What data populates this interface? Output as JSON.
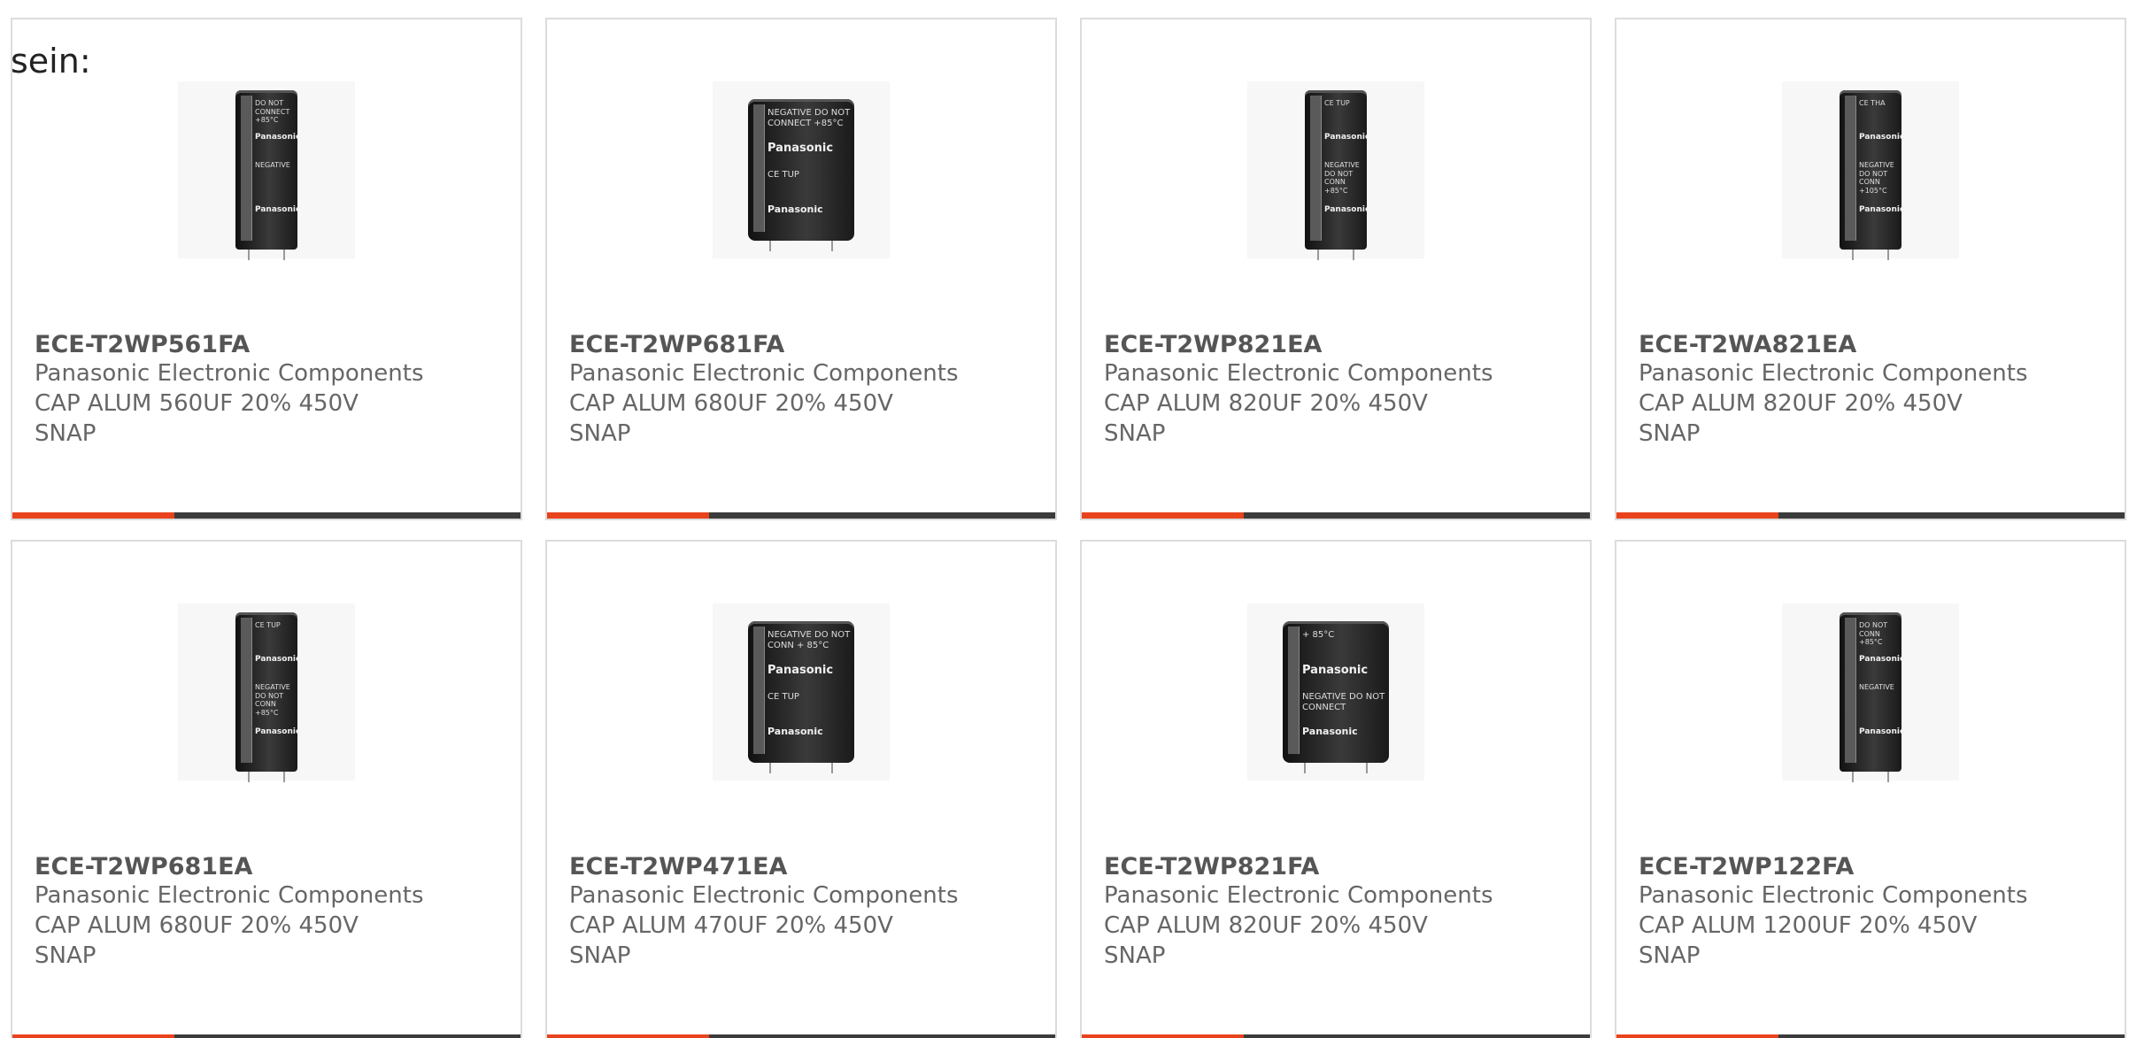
{
  "intro_text": "sein:",
  "colors": {
    "accent": "#e8431c",
    "bar_dark": "#3b3b3b",
    "border": "#dcdcdc"
  },
  "products": [
    {
      "part_number": "ECE-T2WP561FA",
      "manufacturer": "Panasonic Electronic Components",
      "desc_line1": "CAP ALUM 560UF 20% 450V",
      "desc_line2": "SNAP",
      "image": {
        "brand": "Panasonic",
        "text_a": "DO NOT CONNECT +85°C",
        "text_b": "NEGATIVE"
      }
    },
    {
      "part_number": "ECE-T2WP681FA",
      "manufacturer": "Panasonic Electronic Components",
      "desc_line1": "CAP ALUM 680UF 20% 450V",
      "desc_line2": "SNAP",
      "image": {
        "brand": "Panasonic",
        "text_a": "NEGATIVE DO NOT CONNECT +85°C",
        "text_b": "CE TUP"
      }
    },
    {
      "part_number": "ECE-T2WP821EA",
      "manufacturer": "Panasonic Electronic Components",
      "desc_line1": "CAP ALUM 820UF 20% 450V",
      "desc_line2": "SNAP",
      "image": {
        "brand": "Panasonic",
        "text_a": "CE TUP",
        "text_b": "NEGATIVE DO NOT CONN +85°C"
      }
    },
    {
      "part_number": "ECE-T2WA821EA",
      "manufacturer": "Panasonic Electronic Components",
      "desc_line1": "CAP ALUM 820UF 20% 450V",
      "desc_line2": "SNAP",
      "image": {
        "brand": "Panasonic",
        "text_a": "CE THA",
        "text_b": "NEGATIVE DO NOT CONN +105°C"
      }
    },
    {
      "part_number": "ECE-T2WP681EA",
      "manufacturer": "Panasonic Electronic Components",
      "desc_line1": "CAP ALUM 680UF 20% 450V",
      "desc_line2": "SNAP",
      "image": {
        "brand": "Panasonic",
        "text_a": "CE TUP",
        "text_b": "NEGATIVE DO NOT CONN +85°C"
      }
    },
    {
      "part_number": "ECE-T2WP471EA",
      "manufacturer": "Panasonic Electronic Components",
      "desc_line1": "CAP ALUM 470UF 20% 450V",
      "desc_line2": "SNAP",
      "image": {
        "brand": "Panasonic",
        "text_a": "NEGATIVE DO NOT CONN + 85°C",
        "text_b": "CE TUP"
      }
    },
    {
      "part_number": "ECE-T2WP821FA",
      "manufacturer": "Panasonic Electronic Components",
      "desc_line1": "CAP ALUM 820UF 20% 450V",
      "desc_line2": "SNAP",
      "image": {
        "brand": "Panasonic",
        "text_a": "+ 85°C",
        "text_b": "NEGATIVE DO NOT CONNECT"
      }
    },
    {
      "part_number": "ECE-T2WP122FA",
      "manufacturer": "Panasonic Electronic Components",
      "desc_line1": "CAP ALUM 1200UF 20% 450V",
      "desc_line2": "SNAP",
      "image": {
        "brand": "Panasonic",
        "text_a": "DO NOT CONN +85°C",
        "text_b": "NEGATIVE"
      }
    }
  ]
}
